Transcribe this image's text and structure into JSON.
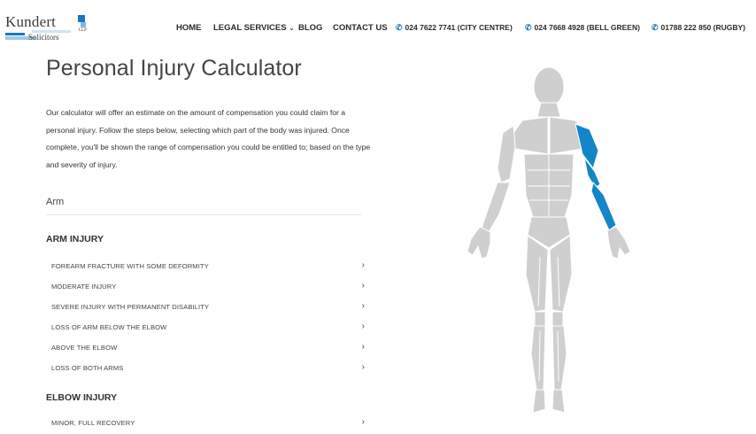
{
  "header": {
    "logo": {
      "name": "Kundert",
      "sub": "Solicitors",
      "llp": "LLP"
    },
    "nav": [
      {
        "label": "HOME"
      },
      {
        "label": "LEGAL SERVICES"
      },
      {
        "label": "BLOG"
      },
      {
        "label": "CONTACT US"
      },
      {
        "label": "024 7622 7741 (CITY CENTRE)"
      },
      {
        "label": "024 7668 4928 (BELL GREEN)"
      },
      {
        "label": "01788 222 850 (RUGBY)"
      }
    ]
  },
  "page": {
    "title": "Personal Injury Calculator",
    "intro": "Our calculator will offer an estimate on the amount of compensation you could claim for a personal injury. Follow the steps below, selecting which part of the body was injured. Once complete, you'll be shown the range of compensation you could be entitled to; based on the type and severity of injury.",
    "selected_area": "Arm"
  },
  "sections": [
    {
      "heading": "ARM INJURY",
      "items": [
        "FOREARM FRACTURE WITH SOME DEFORMITY",
        "MODERATE INJURY",
        "SEVERE INJURY WITH PERMANENT DISABILITY",
        "LOSS OF ARM BELOW THE ELBOW",
        "ABOVE THE ELBOW",
        "LOSS OF BOTH ARMS"
      ]
    },
    {
      "heading": "ELBOW INJURY",
      "items": [
        "MINOR, FULL RECOVERY"
      ]
    }
  ],
  "colors": {
    "accent": "#1b76bb",
    "highlight": "#1286c8",
    "body": "#cfcfcf",
    "body_line": "#ffffff"
  },
  "icons": {
    "phone": "phone-icon",
    "chevron": "chevron-right-icon",
    "dropdown": "chevron-down-icon"
  }
}
